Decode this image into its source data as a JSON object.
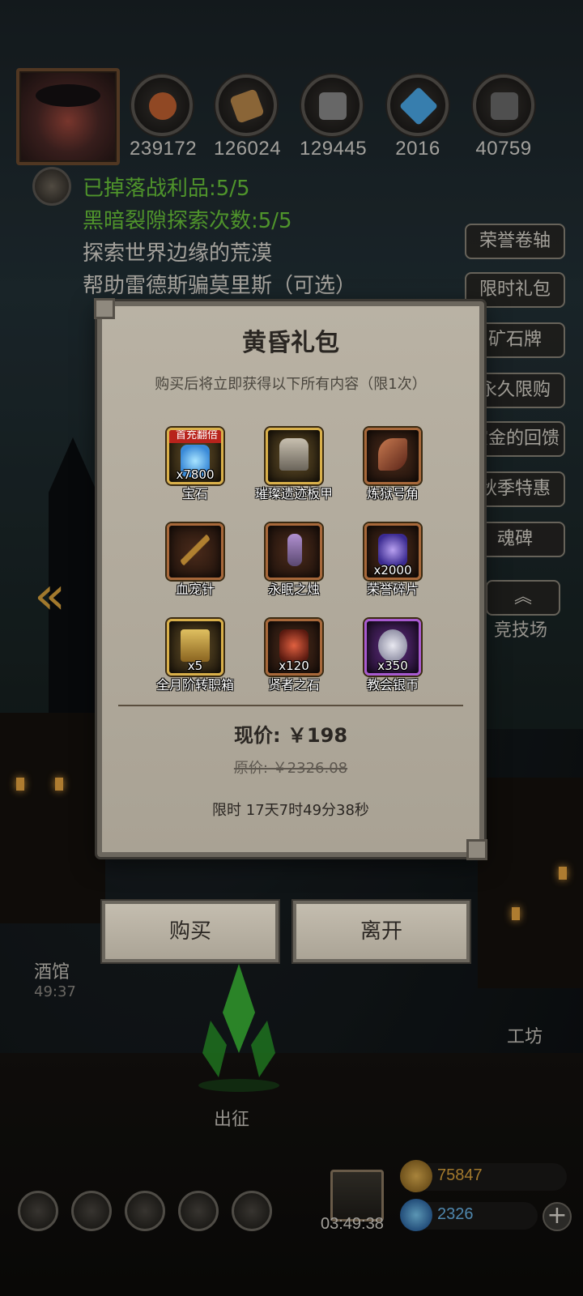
{
  "resources": [
    {
      "name": "food-icon",
      "value": "239172",
      "color": "#c06030"
    },
    {
      "name": "wood-icon",
      "value": "126024",
      "color": "#b8874a"
    },
    {
      "name": "stone-icon",
      "value": "129445",
      "color": "#8a8a8a"
    },
    {
      "name": "crystal-icon",
      "value": "2016",
      "color": "#4aa8e8"
    },
    {
      "name": "iron-icon",
      "value": "40759",
      "color": "#6a6a6a"
    }
  ],
  "quests": [
    "已掉落战利品:5/5",
    "黑暗裂隙探索次数:5/5",
    "探索世界边缘的荒漠",
    "帮助雷德斯骗莫里斯（可选）"
  ],
  "side_menu": [
    "荣誉卷轴",
    "限时礼包",
    "矿石牌",
    "永久限购",
    "赏金的回馈",
    "秋季特惠",
    "魂碑"
  ],
  "arena_label": "竞技场",
  "modal": {
    "title": "黄昏礼包",
    "subtitle": "购买后将立即获得以下所有内容（限1次）",
    "items": [
      {
        "name": "宝石",
        "qty": "x7800",
        "badge": "首充翻倍"
      },
      {
        "name": "璀璨遗迹板甲",
        "qty": "",
        "badge": ""
      },
      {
        "name": "炼狱号角",
        "qty": "",
        "badge": ""
      },
      {
        "name": "血宠针",
        "qty": "",
        "badge": ""
      },
      {
        "name": "永眠之烛",
        "qty": "",
        "badge": ""
      },
      {
        "name": "荣誉碎片",
        "qty": "x2000",
        "badge": ""
      },
      {
        "name": "全月阶转职箱",
        "qty": "x5",
        "badge": ""
      },
      {
        "name": "贤者之石",
        "qty": "x120",
        "badge": ""
      },
      {
        "name": "教会银币",
        "qty": "x350",
        "badge": ""
      }
    ],
    "price_now": "现价: ￥198",
    "price_orig": "原价: ￥2326.08",
    "timer": "限时 17天7时49分38秒",
    "buy_label": "购买",
    "leave_label": "离开"
  },
  "locations": {
    "tavern": "酒馆",
    "tavern_time": "49:37",
    "workshop": "工坊",
    "expedition": "出征"
  },
  "bottom": {
    "gift_timer": "03:49:38",
    "gold": "75847",
    "gems": "2326"
  }
}
